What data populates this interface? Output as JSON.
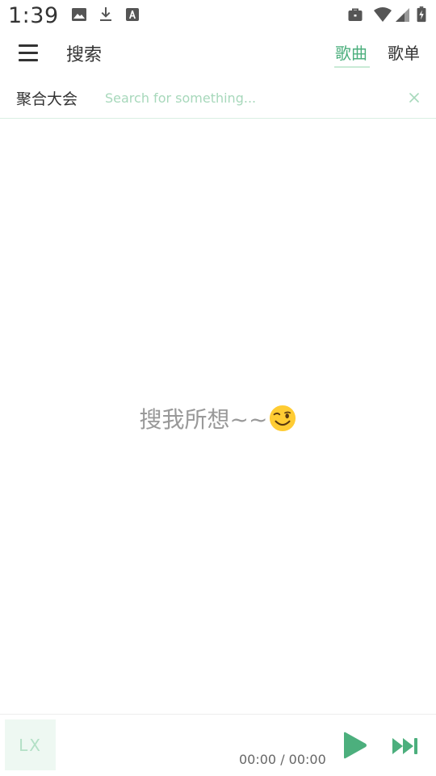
{
  "status_bar": {
    "time": "1:39",
    "left_icons": [
      "image-icon",
      "download-icon",
      "font-a-icon"
    ],
    "right_icons": [
      "briefcase-icon",
      "wifi-icon",
      "signal-icon",
      "battery-charging-icon"
    ]
  },
  "app_bar": {
    "title": "搜索",
    "tabs": [
      {
        "label": "歌曲",
        "active": true
      },
      {
        "label": "歌单",
        "active": false
      }
    ]
  },
  "search": {
    "source": "聚合大会",
    "value": "",
    "placeholder": "Search for something..."
  },
  "empty_state": {
    "text": "搜我所想~~",
    "emoji": "wink-emoji-icon"
  },
  "player": {
    "cover_text": "LX",
    "time": "00:00 / 00:00"
  },
  "colors": {
    "accent": "#4caf7d",
    "accent_light": "#a7d8bb",
    "text": "#333333",
    "muted": "#999999"
  }
}
